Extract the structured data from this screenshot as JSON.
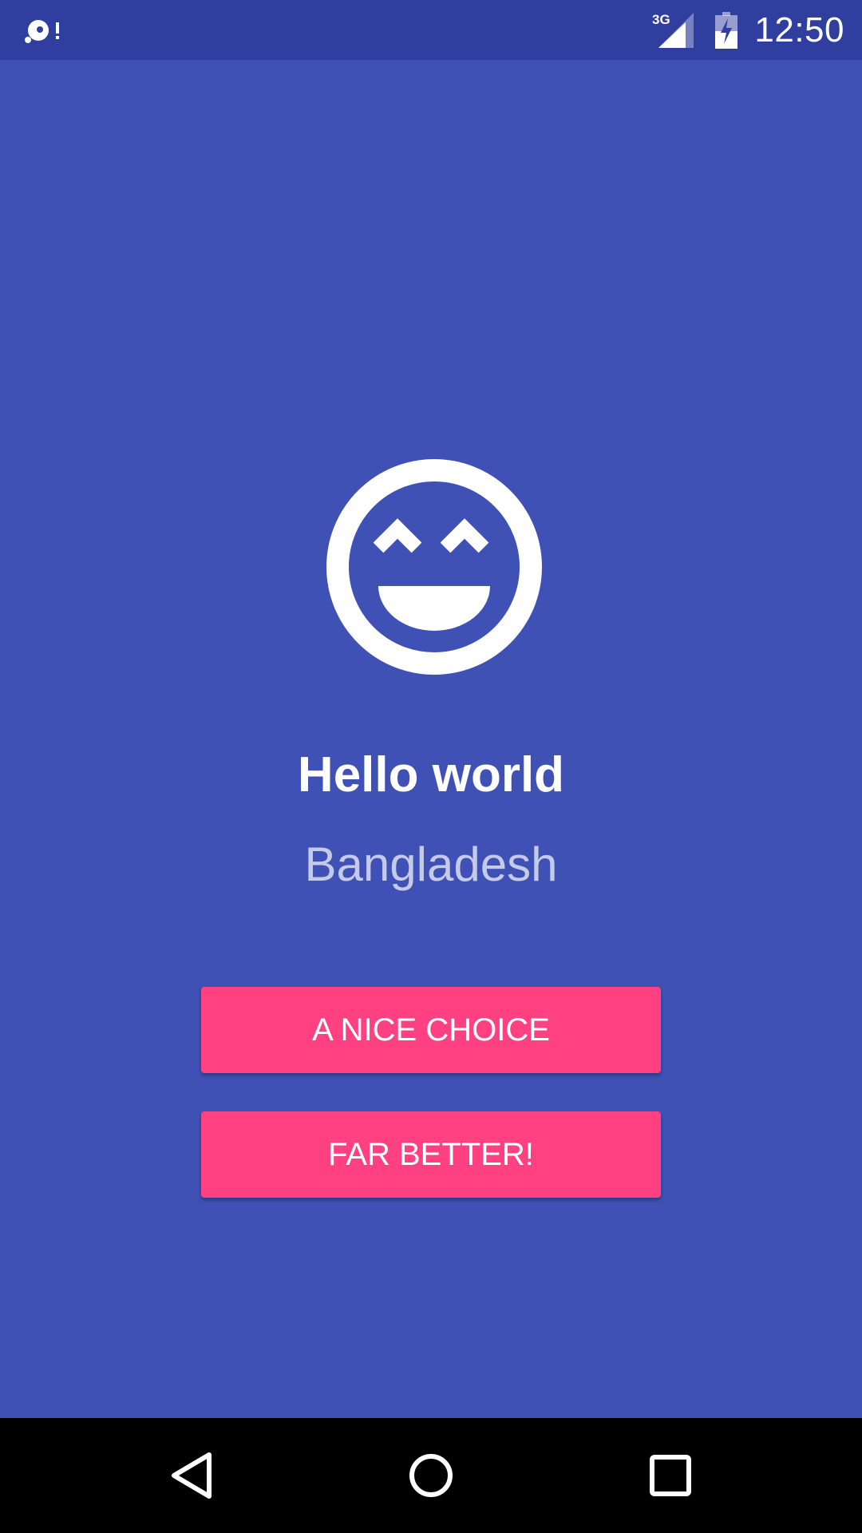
{
  "status_bar": {
    "time": "12:50",
    "network_label": "3G",
    "icons": [
      "notification-icon",
      "signal-3g-icon",
      "battery-charging-icon"
    ]
  },
  "main": {
    "icon": "smiley-icon",
    "title": "Hello world",
    "subtitle": "Bangladesh",
    "buttons": [
      {
        "label": "A NICE CHOICE"
      },
      {
        "label": "FAR BETTER!"
      }
    ]
  },
  "nav_bar": {
    "icons": [
      "back-icon",
      "home-icon",
      "recents-icon"
    ]
  },
  "colors": {
    "background": "#3F51B5",
    "status_bar": "#303F9F",
    "accent": "#FF4081",
    "subtitle": "#C5CAE9"
  }
}
